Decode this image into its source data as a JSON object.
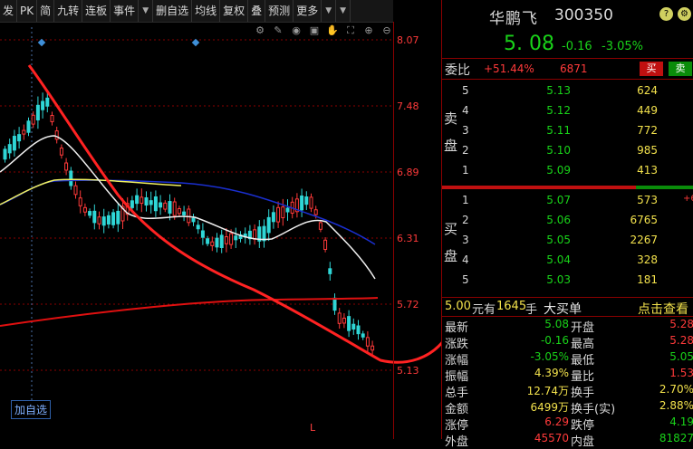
{
  "toolbar": {
    "items": [
      "发",
      "PK",
      "简",
      "九转",
      "连板",
      "事件",
      "删自选",
      "均线",
      "复权",
      "叠",
      "预测",
      "更多"
    ]
  },
  "chart": {
    "price_labels": [
      "8.07",
      "7.48",
      "6.89",
      "6.31",
      "5.72",
      "5.13"
    ],
    "add_watchlist": "加自选",
    "marker": "L"
  },
  "stock": {
    "name": "华鹏飞",
    "code": "300350",
    "price": "5. 08",
    "change": "-0.16",
    "change_pct": "-3.05%"
  },
  "weibi": {
    "label": "委比",
    "ratio": "+51.44%",
    "diff": "6871",
    "buy_btn": "买",
    "sell_btn": "卖"
  },
  "orderbook": {
    "ask_label": "卖盘",
    "bid_label": "买盘",
    "asks": [
      {
        "level": "5",
        "price": "5.13",
        "vol": "624"
      },
      {
        "level": "4",
        "price": "5.12",
        "vol": "449"
      },
      {
        "level": "3",
        "price": "5.11",
        "vol": "772"
      },
      {
        "level": "2",
        "price": "5.10",
        "vol": "985"
      },
      {
        "level": "1",
        "price": "5.09",
        "vol": "413"
      }
    ],
    "bids": [
      {
        "level": "1",
        "price": "5.07",
        "vol": "573",
        "extra": "+6"
      },
      {
        "level": "2",
        "price": "5.06",
        "vol": "6765",
        "extra": ""
      },
      {
        "level": "3",
        "price": "5.05",
        "vol": "2267",
        "extra": ""
      },
      {
        "level": "4",
        "price": "5.04",
        "vol": "328",
        "extra": ""
      },
      {
        "level": "5",
        "price": "5.03",
        "vol": "181",
        "extra": ""
      }
    ]
  },
  "last_trade": {
    "price": "5.00",
    "unit1": "元有",
    "volume": "1645",
    "unit2": "手",
    "type": "大买单",
    "link": "点击查看"
  },
  "stats": [
    {
      "l1": "最新",
      "v1": "5.08",
      "c1": "#19d219",
      "l2": "开盘",
      "v2": "5.28",
      "c2": "#ff3a3a"
    },
    {
      "l1": "涨跌",
      "v1": "-0.16",
      "c1": "#19d219",
      "l2": "最高",
      "v2": "5.28",
      "c2": "#ff3a3a"
    },
    {
      "l1": "涨幅",
      "v1": "-3.05%",
      "c1": "#19d219",
      "l2": "最低",
      "v2": "5.05",
      "c2": "#19d219"
    },
    {
      "l1": "振幅",
      "v1": "4.39%",
      "c1": "#f2e14c",
      "l2": "量比",
      "v2": "1.53",
      "c2": "#ff3a3a"
    },
    {
      "l1": "总手",
      "v1": "12.74万",
      "c1": "#f2e14c",
      "l2": "换手",
      "v2": "2.70%",
      "c2": "#f2e14c"
    },
    {
      "l1": "金额",
      "v1": "6499万",
      "c1": "#f2e14c",
      "l2": "换手(实)",
      "v2": "2.88%",
      "c2": "#f2e14c"
    },
    {
      "l1": "涨停",
      "v1": "6.29",
      "c1": "#ff3a3a",
      "l2": "跌停",
      "v2": "4.19",
      "c2": "#19d219"
    },
    {
      "l1": "外盘",
      "v1": "45570",
      "c1": "#ff3a3a",
      "l2": "内盘",
      "v2": "81827",
      "c2": "#19d219"
    }
  ],
  "colors": {
    "up": "#ff3a3a",
    "down": "#19d219",
    "volume": "#f2e14c"
  }
}
